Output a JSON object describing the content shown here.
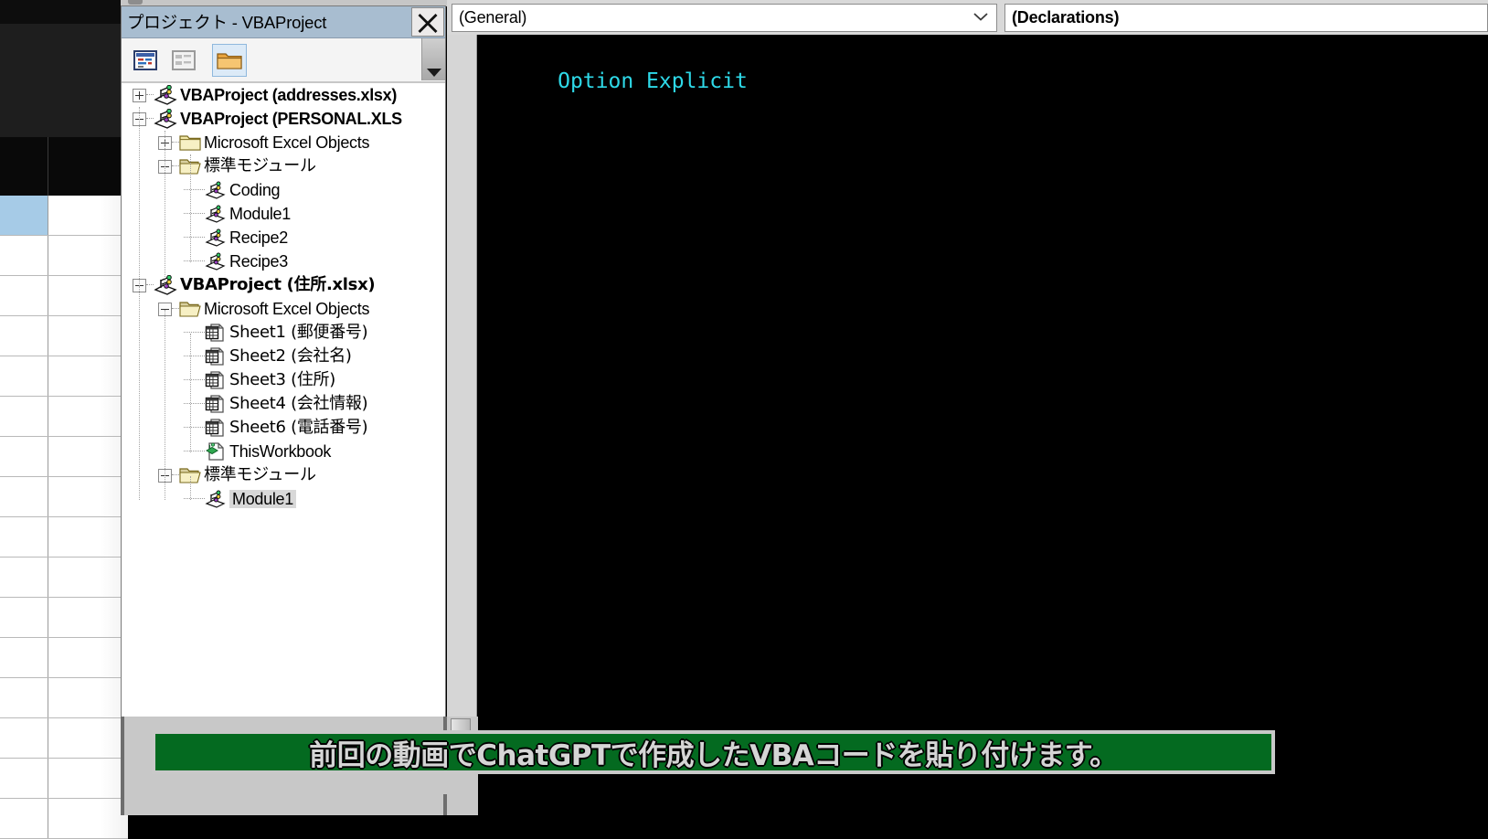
{
  "window": {
    "project_title": "プロジェクト - VBAProject",
    "close_label": "close-icon"
  },
  "toolbar": {
    "buttons": [
      {
        "name": "view-code-button",
        "icon": "code-window-icon"
      },
      {
        "name": "view-object-button",
        "icon": "object-window-icon"
      },
      {
        "name": "toggle-folders-button",
        "icon": "folder-icon"
      }
    ]
  },
  "tree": {
    "nodes": [
      {
        "label": "VBAProject (addresses.xlsx)",
        "icon": "vbaproject-icon",
        "indent": 0,
        "expander": "plus",
        "bold": true,
        "jp": false,
        "selected": false
      },
      {
        "label": "VBAProject (PERSONAL.XLS",
        "icon": "vbaproject-icon",
        "indent": 0,
        "expander": "minus",
        "bold": true,
        "jp": false,
        "selected": false
      },
      {
        "label": "Microsoft Excel Objects",
        "icon": "folder-closed-icon",
        "indent": 1,
        "expander": "plus",
        "bold": false,
        "jp": false,
        "selected": false
      },
      {
        "label": "標準モジュール",
        "icon": "folder-open-icon",
        "indent": 1,
        "expander": "minus",
        "bold": false,
        "jp": true,
        "selected": false
      },
      {
        "label": "Coding",
        "icon": "module-icon",
        "indent": 2,
        "expander": "none",
        "bold": false,
        "jp": false,
        "selected": false
      },
      {
        "label": "Module1",
        "icon": "module-icon",
        "indent": 2,
        "expander": "none",
        "bold": false,
        "jp": false,
        "selected": false
      },
      {
        "label": "Recipe2",
        "icon": "module-icon",
        "indent": 2,
        "expander": "none",
        "bold": false,
        "jp": false,
        "selected": false
      },
      {
        "label": "Recipe3",
        "icon": "module-icon",
        "indent": 2,
        "expander": "none",
        "bold": false,
        "jp": false,
        "selected": false
      },
      {
        "label": "VBAProject (住所.xlsx)",
        "icon": "vbaproject-icon",
        "indent": 0,
        "expander": "minus",
        "bold": true,
        "jp": true,
        "selected": false
      },
      {
        "label": "Microsoft Excel Objects",
        "icon": "folder-open-icon",
        "indent": 1,
        "expander": "minus",
        "bold": false,
        "jp": false,
        "selected": false
      },
      {
        "label": "Sheet1 (郵便番号)",
        "icon": "sheet-icon",
        "indent": 2,
        "expander": "none",
        "bold": false,
        "jp": true,
        "selected": false
      },
      {
        "label": "Sheet2 (会社名)",
        "icon": "sheet-icon",
        "indent": 2,
        "expander": "none",
        "bold": false,
        "jp": true,
        "selected": false
      },
      {
        "label": "Sheet3 (住所)",
        "icon": "sheet-icon",
        "indent": 2,
        "expander": "none",
        "bold": false,
        "jp": true,
        "selected": false
      },
      {
        "label": "Sheet4 (会社情報)",
        "icon": "sheet-icon",
        "indent": 2,
        "expander": "none",
        "bold": false,
        "jp": true,
        "selected": false
      },
      {
        "label": "Sheet6 (電話番号)",
        "icon": "sheet-icon",
        "indent": 2,
        "expander": "none",
        "bold": false,
        "jp": true,
        "selected": false
      },
      {
        "label": "ThisWorkbook",
        "icon": "workbook-icon",
        "indent": 2,
        "expander": "none",
        "bold": false,
        "jp": false,
        "selected": false
      },
      {
        "label": "標準モジュール",
        "icon": "folder-open-icon",
        "indent": 1,
        "expander": "minus",
        "bold": false,
        "jp": true,
        "selected": false
      },
      {
        "label": "Module1",
        "icon": "module-icon",
        "indent": 2,
        "expander": "none",
        "bold": false,
        "jp": false,
        "selected": true
      }
    ]
  },
  "code_editor": {
    "object_combo_value": "(General)",
    "procedure_combo_value": "(Declarations)",
    "lines": [
      "Option Explicit"
    ],
    "code_color": "#2ed9e8",
    "background_color": "#000000"
  },
  "caption": {
    "text": "前回の動画でChatGPTで作成したVBAコードを貼り付けます。",
    "background_color": "#046a20",
    "text_color": "#d5d5d5"
  },
  "spreadsheet": {
    "selected_cell_color": "#a6cbe7",
    "rows": 16
  }
}
